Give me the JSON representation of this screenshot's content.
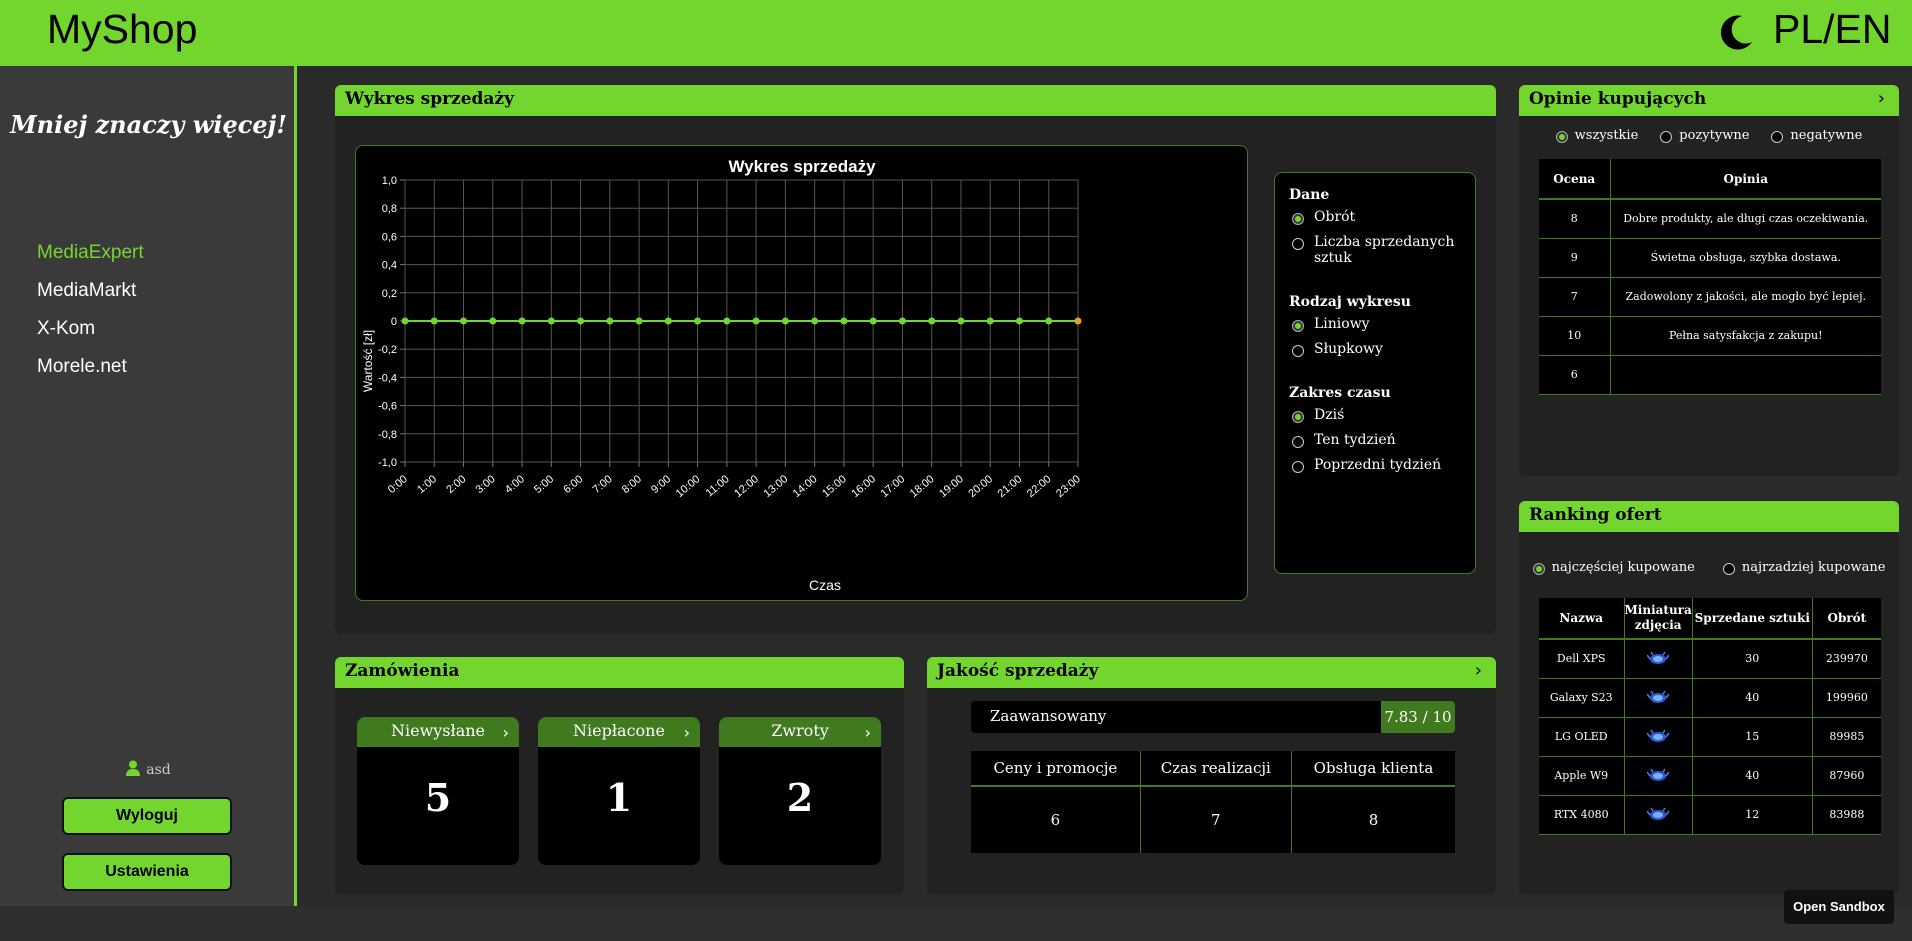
{
  "header": {
    "brand": "MyShop",
    "lang": "PL/EN"
  },
  "sidebar": {
    "motto": "Mniej znaczy więcej!",
    "shops": [
      {
        "label": "MediaExpert",
        "active": true
      },
      {
        "label": "MediaMarkt",
        "active": false
      },
      {
        "label": "X-Kom",
        "active": false
      },
      {
        "label": "Morele.net",
        "active": false
      }
    ],
    "user": "asd",
    "logout": "Wyloguj",
    "settings": "Ustawienia"
  },
  "sales": {
    "panel_title": "Wykres sprzedaży",
    "legend": {
      "data_title": "Dane",
      "data_opts": [
        "Obrót",
        "Liczba sprzedanych sztuk"
      ],
      "type_title": "Rodzaj wykresu",
      "type_opts": [
        "Liniowy",
        "Słupkowy"
      ],
      "range_title": "Zakres czasu",
      "range_opts": [
        "Dziś",
        "Ten tydzień",
        "Poprzedni tydzień"
      ]
    }
  },
  "chart_data": {
    "type": "line",
    "title": "Wykres sprzedaży",
    "xlabel": "Czas",
    "ylabel": "Wartość [zł]",
    "x": [
      "0:00",
      "1:00",
      "2:00",
      "3:00",
      "4:00",
      "5:00",
      "6:00",
      "7:00",
      "8:00",
      "9:00",
      "10:00",
      "11:00",
      "12:00",
      "13:00",
      "14:00",
      "15:00",
      "16:00",
      "17:00",
      "18:00",
      "19:00",
      "20:00",
      "21:00",
      "22:00",
      "23:00"
    ],
    "series": [
      {
        "values": [
          0,
          0,
          0,
          0,
          0,
          0,
          0,
          0,
          0,
          0,
          0,
          0,
          0,
          0,
          0,
          0,
          0,
          0,
          0,
          0,
          0,
          0,
          0,
          0
        ]
      }
    ],
    "ylim": [
      -1.0,
      1.0
    ],
    "yticks": [
      "1,0",
      "0,8",
      "0,6",
      "0,4",
      "0,2",
      "0",
      "-0,2",
      "-0,4",
      "-0,6",
      "-0,8",
      "-1,0"
    ],
    "grid": true,
    "colors": {
      "line": "#72d62f",
      "last_point": "#e8a020"
    }
  },
  "orders": {
    "title": "Zamówienia",
    "cards": [
      {
        "label": "Niewysłane",
        "value": "5"
      },
      {
        "label": "Niepłacone",
        "value": "1"
      },
      {
        "label": "Zwroty",
        "value": "2"
      }
    ]
  },
  "quality": {
    "title": "Jakość sprzedaży",
    "level": "Zaawansowany",
    "score": "7.83 / 10",
    "columns": [
      "Ceny i promocje",
      "Czas realizacji",
      "Obsługa klienta"
    ],
    "values": [
      "6",
      "7",
      "8"
    ]
  },
  "opinions": {
    "title": "Opinie kupujących",
    "filters": [
      "wszystkie",
      "pozytywne",
      "negatywne"
    ],
    "columns": [
      "Ocena",
      "Opinia"
    ],
    "rows": [
      {
        "score": "8",
        "text": "Dobre produkty, ale długi czas oczekiwania."
      },
      {
        "score": "9",
        "text": "Świetna obsługa, szybka dostawa."
      },
      {
        "score": "7",
        "text": "Zadowolony z jakości, ale mogło być lepiej."
      },
      {
        "score": "10",
        "text": "Pełna satysfakcja z zakupu!"
      },
      {
        "score": "6",
        "text": ""
      }
    ]
  },
  "ranking": {
    "title": "Ranking ofert",
    "filters": [
      "najczęściej kupowane",
      "najrzadziej kupowane"
    ],
    "columns": [
      "Nazwa",
      "Miniatura zdjęcia",
      "Sprzedane sztuki",
      "Obrót"
    ],
    "rows": [
      {
        "name": "Dell XPS",
        "sold": "30",
        "revenue": "239970"
      },
      {
        "name": "Galaxy S23",
        "sold": "40",
        "revenue": "199960"
      },
      {
        "name": "LG OLED",
        "sold": "15",
        "revenue": "89985"
      },
      {
        "name": "Apple W9",
        "sold": "40",
        "revenue": "87960"
      },
      {
        "name": "RTX 4080",
        "sold": "12",
        "revenue": "83988"
      }
    ]
  },
  "sandbox": "Open Sandbox",
  "colors": {
    "accent": "#72d62f",
    "dark_accent": "#3f7a1e",
    "bg": "#2a2a2a",
    "panel": "#222222"
  }
}
